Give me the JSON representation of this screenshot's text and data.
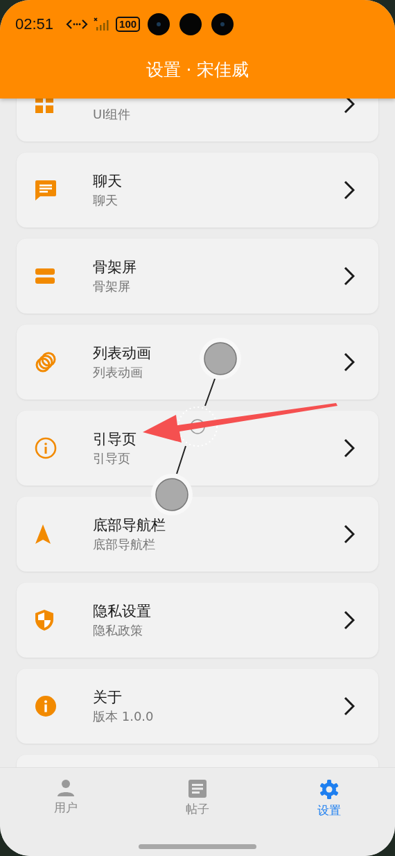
{
  "status_bar": {
    "time": "02:51",
    "battery": "100"
  },
  "header": {
    "title": "设置 · 宋佳威"
  },
  "items": [
    {
      "subtitle": "UI组件"
    },
    {
      "title": "聊天",
      "subtitle": "聊天"
    },
    {
      "title": "骨架屏",
      "subtitle": "骨架屏"
    },
    {
      "title": "列表动画",
      "subtitle": "列表动画"
    },
    {
      "title": "引导页",
      "subtitle": "引导页"
    },
    {
      "title": "底部导航栏",
      "subtitle": "底部导航栏"
    },
    {
      "title": "隐私设置",
      "subtitle": "隐私政策"
    },
    {
      "title": "关于",
      "subtitle": "版本 1.0.0"
    }
  ],
  "tabs": [
    {
      "label": "用户",
      "selected": false
    },
    {
      "label": "帖子",
      "selected": false
    },
    {
      "label": "设置",
      "selected": true
    }
  ]
}
